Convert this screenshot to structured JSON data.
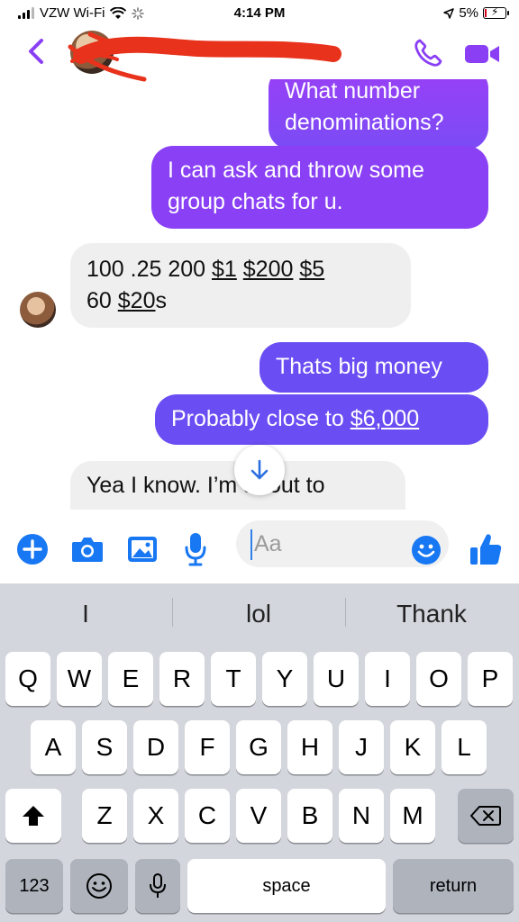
{
  "status_bar": {
    "carrier": "VZW Wi-Fi",
    "time": "4:14 PM",
    "battery": "5%"
  },
  "header": {
    "back_icon": "chevron-left-icon",
    "call_icon": "phone-icon",
    "video_icon": "video-camera-icon",
    "accent": "#8a3ff5"
  },
  "messages": [
    {
      "side": "out",
      "text": "What number denominations?"
    },
    {
      "side": "out",
      "text": "I can ask and throw some group chats for u."
    },
    {
      "side": "in",
      "line1": [
        "100 .25 200 ",
        "$1",
        " ",
        "$200",
        " ",
        "$5"
      ],
      "line2": [
        "60 ",
        "$20",
        "s"
      ]
    },
    {
      "side": "out",
      "text": "Thats big money"
    },
    {
      "side": "out",
      "prefix": "Probably close to ",
      "link": "$6,000"
    },
    {
      "side": "in",
      "text": "Yea I know. I’m about to"
    }
  ],
  "composer": {
    "placeholder": "Aa",
    "icons": [
      "plus-icon",
      "camera-icon",
      "image-icon",
      "microphone-icon",
      "emoji-icon",
      "thumbs-up-icon"
    ]
  },
  "keyboard": {
    "suggestions": [
      "I",
      "lol",
      "Thank"
    ],
    "row1": [
      "Q",
      "W",
      "E",
      "R",
      "T",
      "Y",
      "U",
      "I",
      "O",
      "P"
    ],
    "row2": [
      "A",
      "S",
      "D",
      "F",
      "G",
      "H",
      "J",
      "K",
      "L"
    ],
    "row3": [
      "Z",
      "X",
      "C",
      "V",
      "B",
      "N",
      "M"
    ],
    "numbers_key": "123",
    "space_key": "space",
    "return_key": "return"
  }
}
